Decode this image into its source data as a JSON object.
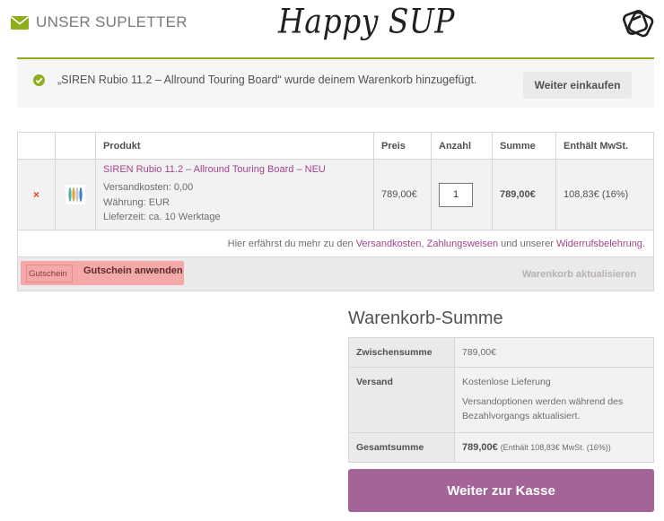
{
  "header": {
    "newsletter_label": "UNSER SUPLETTER",
    "logo_text": "Happy SUP"
  },
  "notice": {
    "message": "„SIREN Rubio 11.2 – Allround Touring Board“ wurde deinem Warenkorb hinzugefügt.",
    "continue_label": "Weiter einkaufen"
  },
  "cart": {
    "columns": [
      "Produkt",
      "Preis",
      "Anzahl",
      "Summe",
      "Enthält MwSt."
    ],
    "item": {
      "remove_symbol": "×",
      "name": "SIREN Rubio 11.2 – Allround Touring Board – NEU",
      "shipping": "Versandkosten: 0,00",
      "currency": "Währung: EUR",
      "delivery": "Lieferzeit: ca. 10 Werktage",
      "price": "789,00€",
      "quantity": "1",
      "subtotal": "789,00€",
      "tax": "108,83€ (16%)"
    },
    "info": {
      "prefix": "Hier erfährst du mehr zu den ",
      "link_shipping": "Versandkosten",
      "sep1": ", ",
      "link_payment": "Zahlungsweisen",
      "mid": " und unserer ",
      "link_withdrawal": "Widerrufsbelehrung",
      "suffix": "."
    },
    "coupon_placeholder": "Gutschein",
    "coupon_button": "Gutschein anwenden",
    "update_button": "Warenkorb aktualisieren"
  },
  "totals": {
    "title": "Warenkorb-Summe",
    "subtotal_label": "Zwischensumme",
    "subtotal_value": "789,00€",
    "shipping_label": "Versand",
    "shipping_value": "Kostenlose Lieferung",
    "shipping_note": "Versandoptionen werden während des Bezahlvorgangs aktualisiert.",
    "total_label": "Gesamtsumme",
    "total_value": "789,00€",
    "total_tax": "(Enthält 108,83€ MwSt. (16%))"
  },
  "checkout_button": "Weiter zur Kasse",
  "colors": {
    "accent_green": "#8fae1b",
    "accent_purple": "#a46497",
    "link_purple": "#a0458c",
    "remove_red": "#e2401c",
    "coupon_highlight": "#f4a9a8"
  },
  "icons": {
    "newsletter": "envelope-icon",
    "logo_mark": "board-stack-icon",
    "notice": "check-circle-icon",
    "product": "sup-board-thumbnail"
  }
}
